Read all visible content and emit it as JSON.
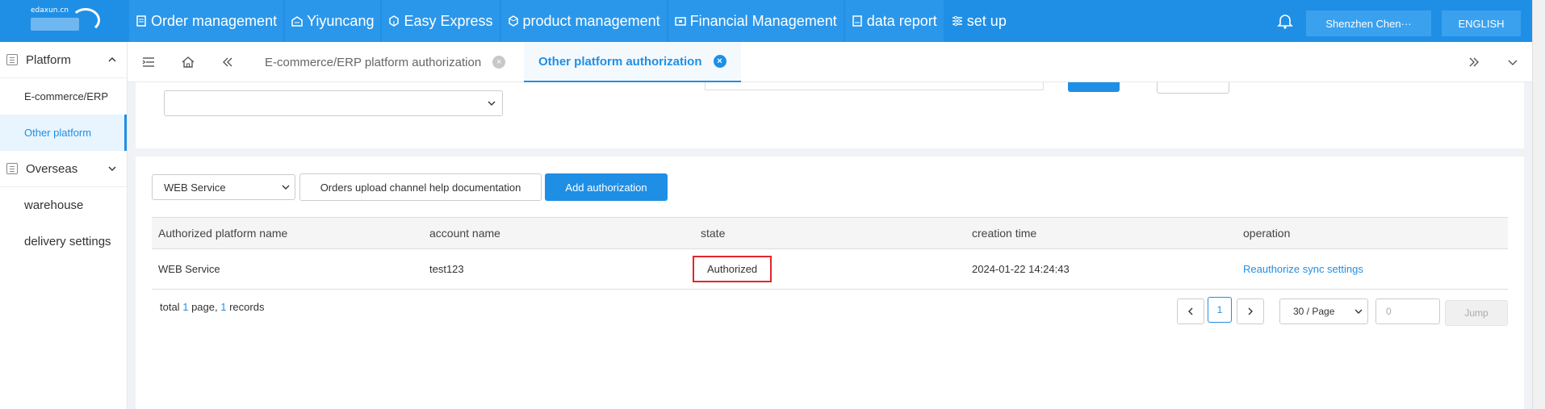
{
  "logo": {
    "text": "edaxun.cn"
  },
  "topnav": {
    "items": [
      {
        "label": "Order management",
        "icon": "document-icon"
      },
      {
        "label": "Yiyuncang",
        "icon": "warehouse-icon"
      },
      {
        "label": "Easy Express",
        "icon": "package-icon"
      },
      {
        "label": "product management",
        "icon": "box-icon"
      },
      {
        "label": "Financial Management",
        "icon": "finance-icon"
      },
      {
        "label": "data report",
        "icon": "report-icon"
      },
      {
        "label": "set up",
        "icon": "sliders-icon"
      }
    ],
    "user": "Shenzhen Chen···",
    "language": "ENGLISH"
  },
  "sidebar": {
    "groups": [
      {
        "label": "Platform",
        "expanded": true,
        "items": [
          "E-commerce/ERP",
          "Other platform"
        ],
        "active": "Other platform"
      },
      {
        "label": "Overseas",
        "expanded": true,
        "items": [
          "warehouse",
          "delivery settings"
        ]
      }
    ]
  },
  "tabs": [
    {
      "label": "E-commerce/ERP platform authorization",
      "active": false
    },
    {
      "label": "Other platform authorization",
      "active": true
    }
  ],
  "toolbar": {
    "platform_select": "WEB Service",
    "help_button": "Orders upload channel help documentation",
    "add_button": "Add authorization"
  },
  "table": {
    "headers": [
      "Authorized platform name",
      "account name",
      "state",
      "creation time",
      "operation"
    ],
    "rows": [
      {
        "platform": "WEB Service",
        "account": "test123",
        "state": "Authorized",
        "created": "2024-01-22 14:24:43",
        "operation": "Reauthorize sync settings"
      }
    ]
  },
  "summary": {
    "prefix": "total",
    "pages": "1",
    "mid": "page,",
    "records": "1",
    "suffix": "records"
  },
  "pagination": {
    "current": "1",
    "page_size": "30 / Page",
    "jump_value": "0",
    "jump_label": "Jump"
  },
  "colors": {
    "primary": "#1f8fe6",
    "highlight": "#e0262e"
  }
}
